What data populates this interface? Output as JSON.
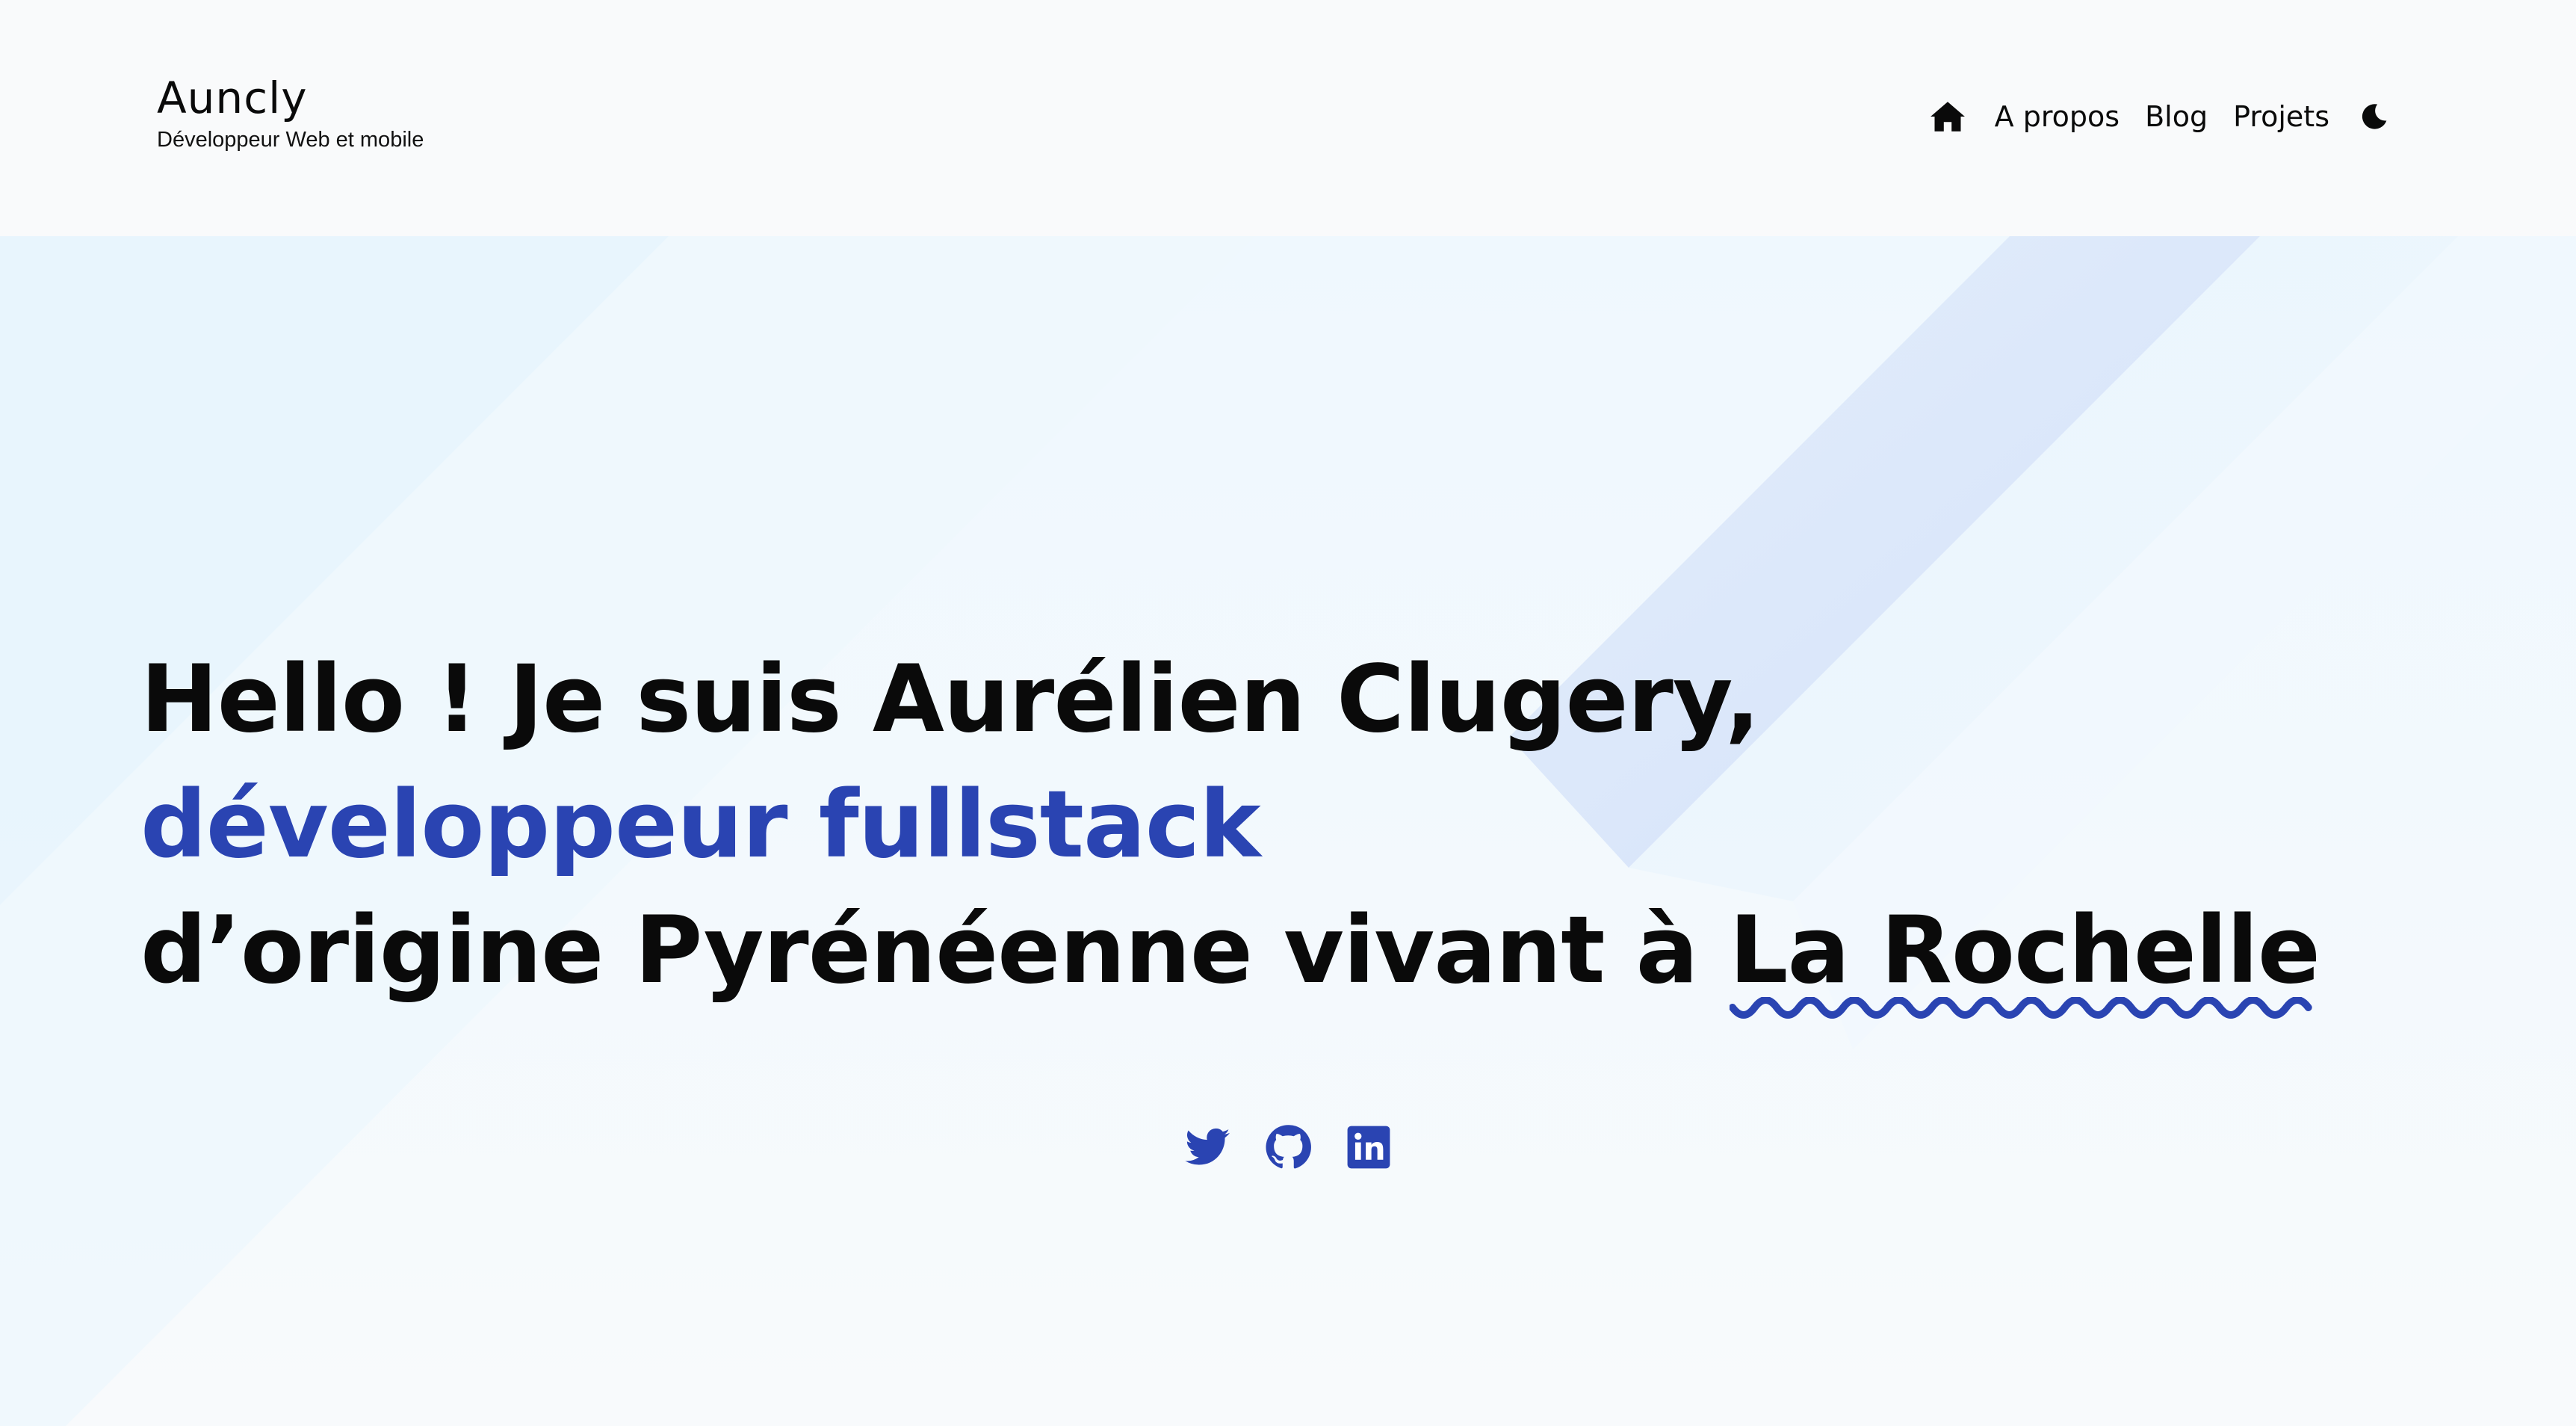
{
  "header": {
    "brand_title": "Auncly",
    "brand_subtitle": "Développeur Web et mobile",
    "nav": {
      "home_icon": "home-icon",
      "about": "A propos",
      "blog": "Blog",
      "projects": "Projets",
      "theme_icon": "moon-icon"
    }
  },
  "hero": {
    "line1": "Hello ! Je suis Aurélien Clugery,",
    "line2": "développeur fullstack",
    "line3_prefix": "d’origine Pyrénéenne vivant à ",
    "line3_place": "La Rochelle",
    "socials": [
      "twitter-icon",
      "github-icon",
      "linkedin-icon"
    ]
  },
  "colors": {
    "accent": "#2a44b2",
    "text": "#0a0a0a",
    "background": "#f9fafb",
    "hero_background": "#eff8fe"
  }
}
